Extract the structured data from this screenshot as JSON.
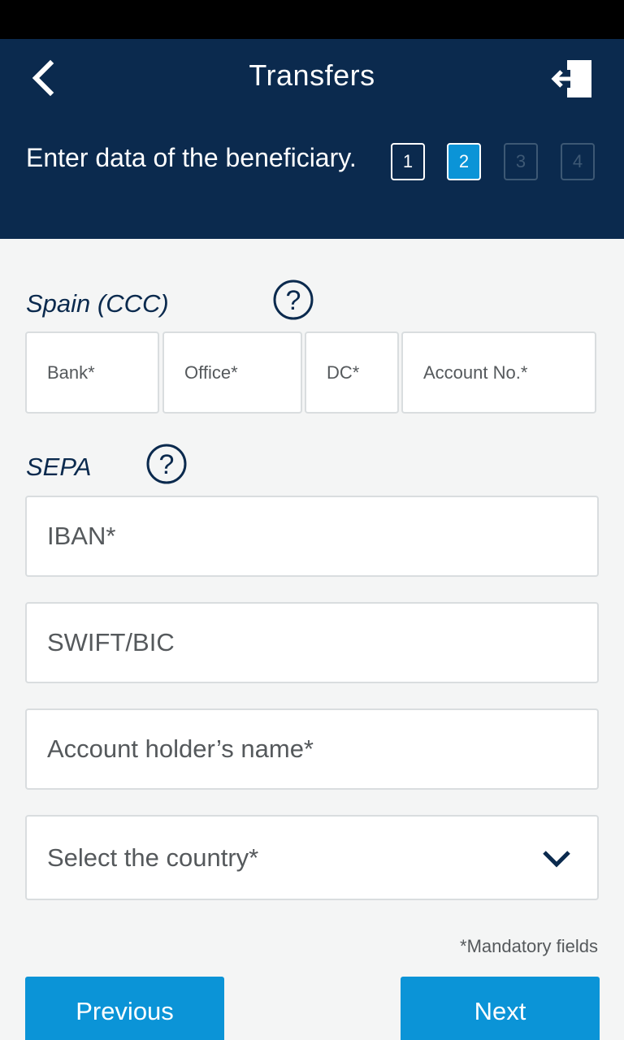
{
  "header": {
    "title": "Transfers",
    "back_icon": "chevron-left-icon",
    "logout_icon": "logout-icon"
  },
  "steps": {
    "caption": "Enter data of the beneficiary.",
    "items": [
      "1",
      "2",
      "3",
      "4"
    ],
    "current": 2
  },
  "ccc": {
    "label": "Spain (CCC)",
    "bank_placeholder": "Bank*",
    "office_placeholder": "Office*",
    "dc_placeholder": "DC*",
    "account_placeholder": "Account No.*"
  },
  "sepa": {
    "label": "SEPA",
    "iban_placeholder": "IBAN*",
    "swift_placeholder": "SWIFT/BIC",
    "holder_placeholder": "Account holder’s name*",
    "country_placeholder": "Select the country*"
  },
  "footer": {
    "mandatory_note": "*Mandatory fields",
    "previous_label": "Previous",
    "next_label": "Next"
  },
  "colors": {
    "header_bg": "#0b2a4e",
    "accent": "#0b94d7",
    "page_bg": "#f4f5f5"
  }
}
